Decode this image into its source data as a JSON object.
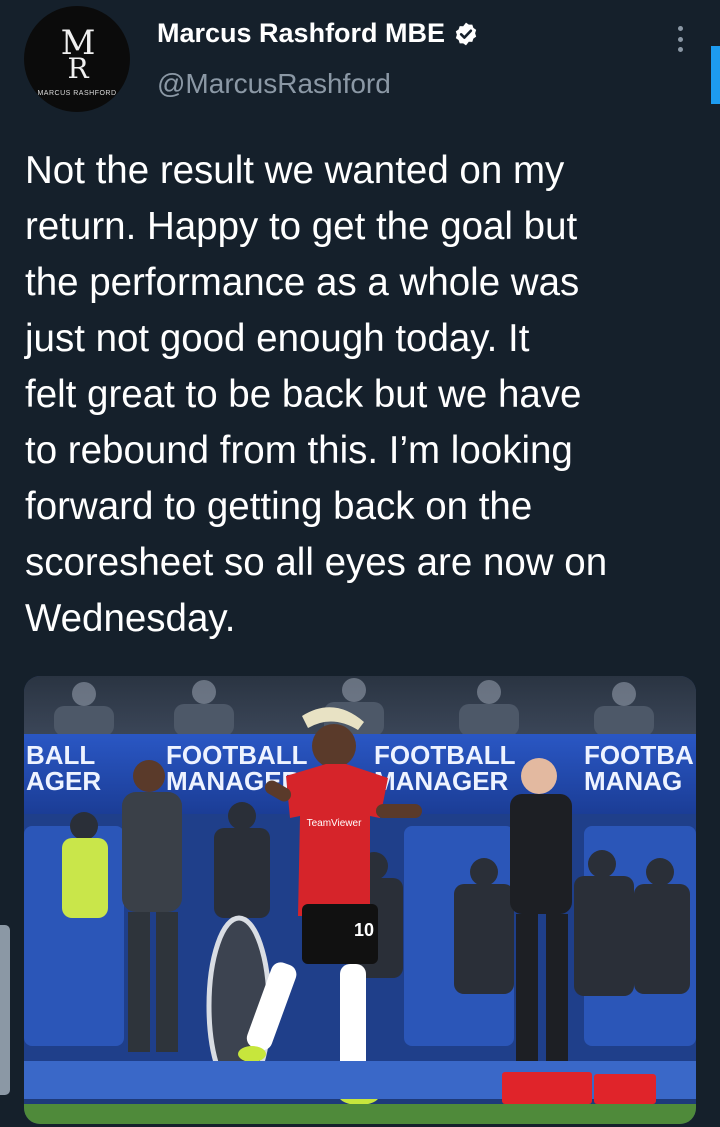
{
  "author": {
    "display_name": "Marcus Rashford MBE",
    "handle": "@MarcusRashford",
    "verified": true,
    "avatar": {
      "monogram_top": "M",
      "monogram_bottom": "R",
      "brand_text": "MARCUS RASHFORD"
    }
  },
  "tweet": {
    "text": "Not the result we wanted on my\nreturn. Happy to get the goal but\nthe performance as a whole was\njust not good enough today. It\nfelt great to be back but we have\nto rebound from this. I’m looking\nforward to getting back on the\nscoresheet so all eyes are now on\nWednesday."
  },
  "media": {
    "board_texts": [
      "BALL\nAGER",
      "FOOTBALL\nMANAGER",
      "FOOTBALL\nMANAGER",
      "FOOTBA\nMANAG"
    ],
    "shirt_number": "10",
    "shirt_sponsor": "TeamViewer"
  },
  "icons": {
    "verified": "verified-badge-icon",
    "more": "more-options-icon"
  },
  "colors": {
    "background": "#15202b",
    "secondary_text": "#8b98a5",
    "accent": "#1d9bf0"
  }
}
